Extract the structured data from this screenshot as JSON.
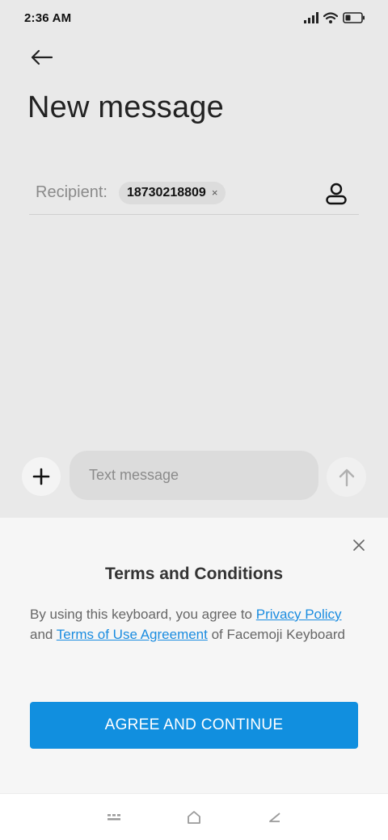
{
  "status_bar": {
    "time": "2:36 AM"
  },
  "header": {
    "title": "New message"
  },
  "recipient": {
    "label": "Recipient:",
    "chip_number": "18730218809",
    "chip_remove": "×"
  },
  "compose": {
    "placeholder": "Text message"
  },
  "terms": {
    "title": "Terms and Conditions",
    "body_prefix": "By using this keyboard, you agree to ",
    "privacy_link": "Privacy Policy",
    "and_text": " and ",
    "terms_link": "Terms of Use Agreement",
    "body_suffix": " of Facemoji Keyboard",
    "agree_button": "AGREE AND CONTINUE"
  },
  "colors": {
    "accent": "#118fdf",
    "link": "#1a8ce0",
    "background": "#e9e9e9",
    "sheet": "#f6f6f6"
  }
}
